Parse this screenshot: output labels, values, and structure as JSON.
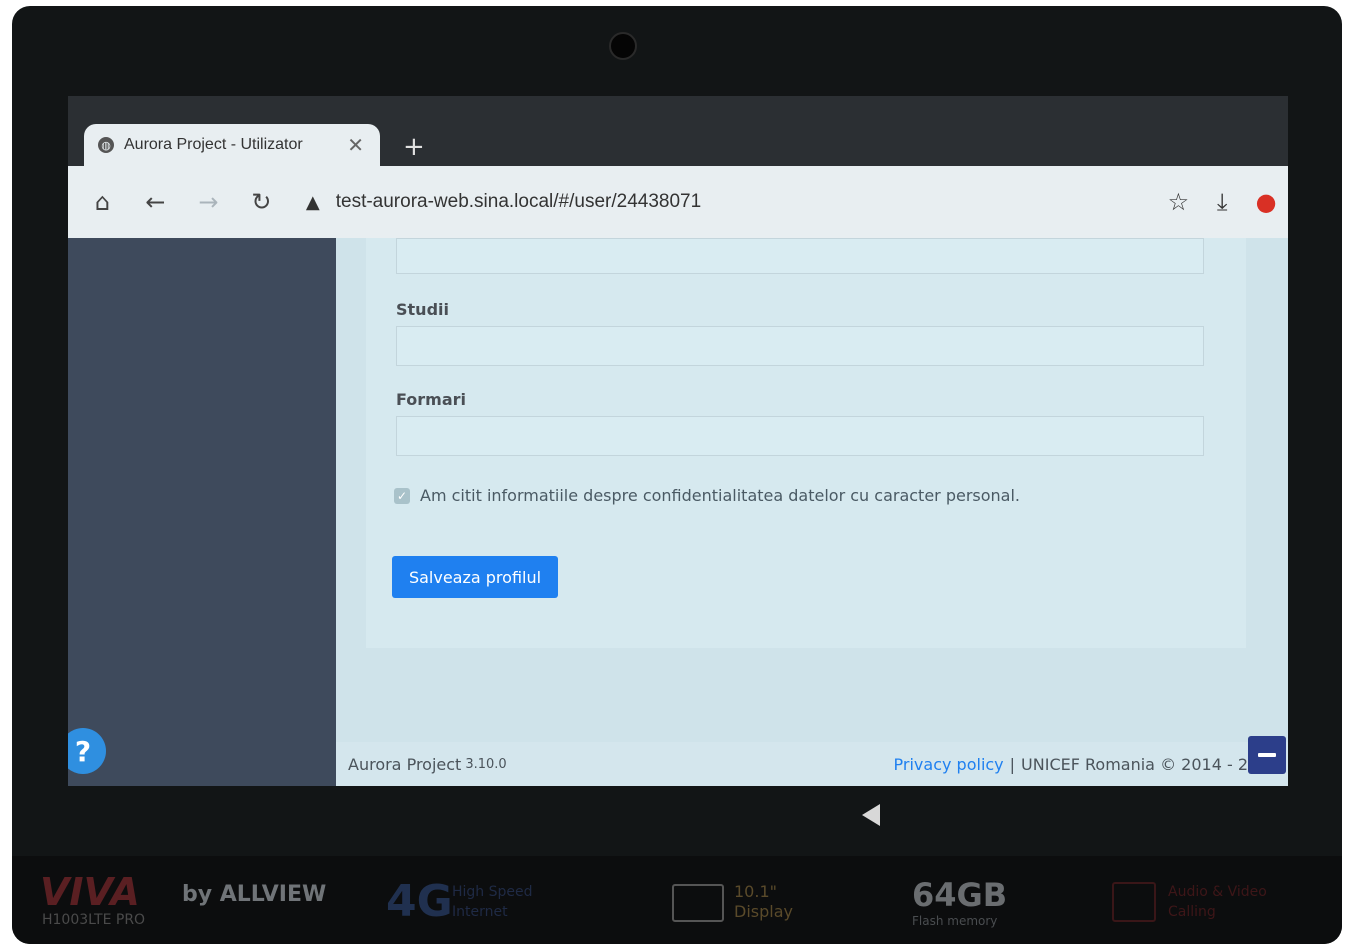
{
  "browser": {
    "tab_title": "Aurora Project - Utilizator",
    "close_glyph": "✕",
    "newtab_glyph": "+",
    "url": "test-aurora-web.sina.local/#/user/24438071",
    "icons": [
      "home-icon",
      "back-icon",
      "forward-icon",
      "reload-icon",
      "warning-icon",
      "star-icon",
      "download-icon",
      "extension-icon"
    ]
  },
  "form": {
    "studii_label": "Studii",
    "formari_label": "Formari",
    "consent_text": "Am citit informatiile despre confidentialitatea datelor cu caracter personal.",
    "consent_checked": true,
    "save_label": "Salveaza profilul"
  },
  "footer": {
    "app_name": "Aurora Project",
    "version": "3.10.0",
    "privacy_link": "Privacy policy",
    "separator": "|",
    "copyright": "UNICEF Romania © 2014 - 2"
  },
  "help_glyph": "?",
  "device_branding": {
    "viva": "VIVA",
    "model": "H1003LTE PRO",
    "allview": "by ALLVIEW",
    "network": "4G",
    "network_sub": "High Speed Internet",
    "display_size": "10.1\"",
    "display_label": "Display",
    "memory": "64GB",
    "memory_label": "Flash memory",
    "calling": "Audio & Video Calling"
  },
  "colors": {
    "accent": "#1f80f0",
    "sidebar": "#3e4a5c",
    "content_bg": "#cfe3ea",
    "bezel": "#121516"
  }
}
